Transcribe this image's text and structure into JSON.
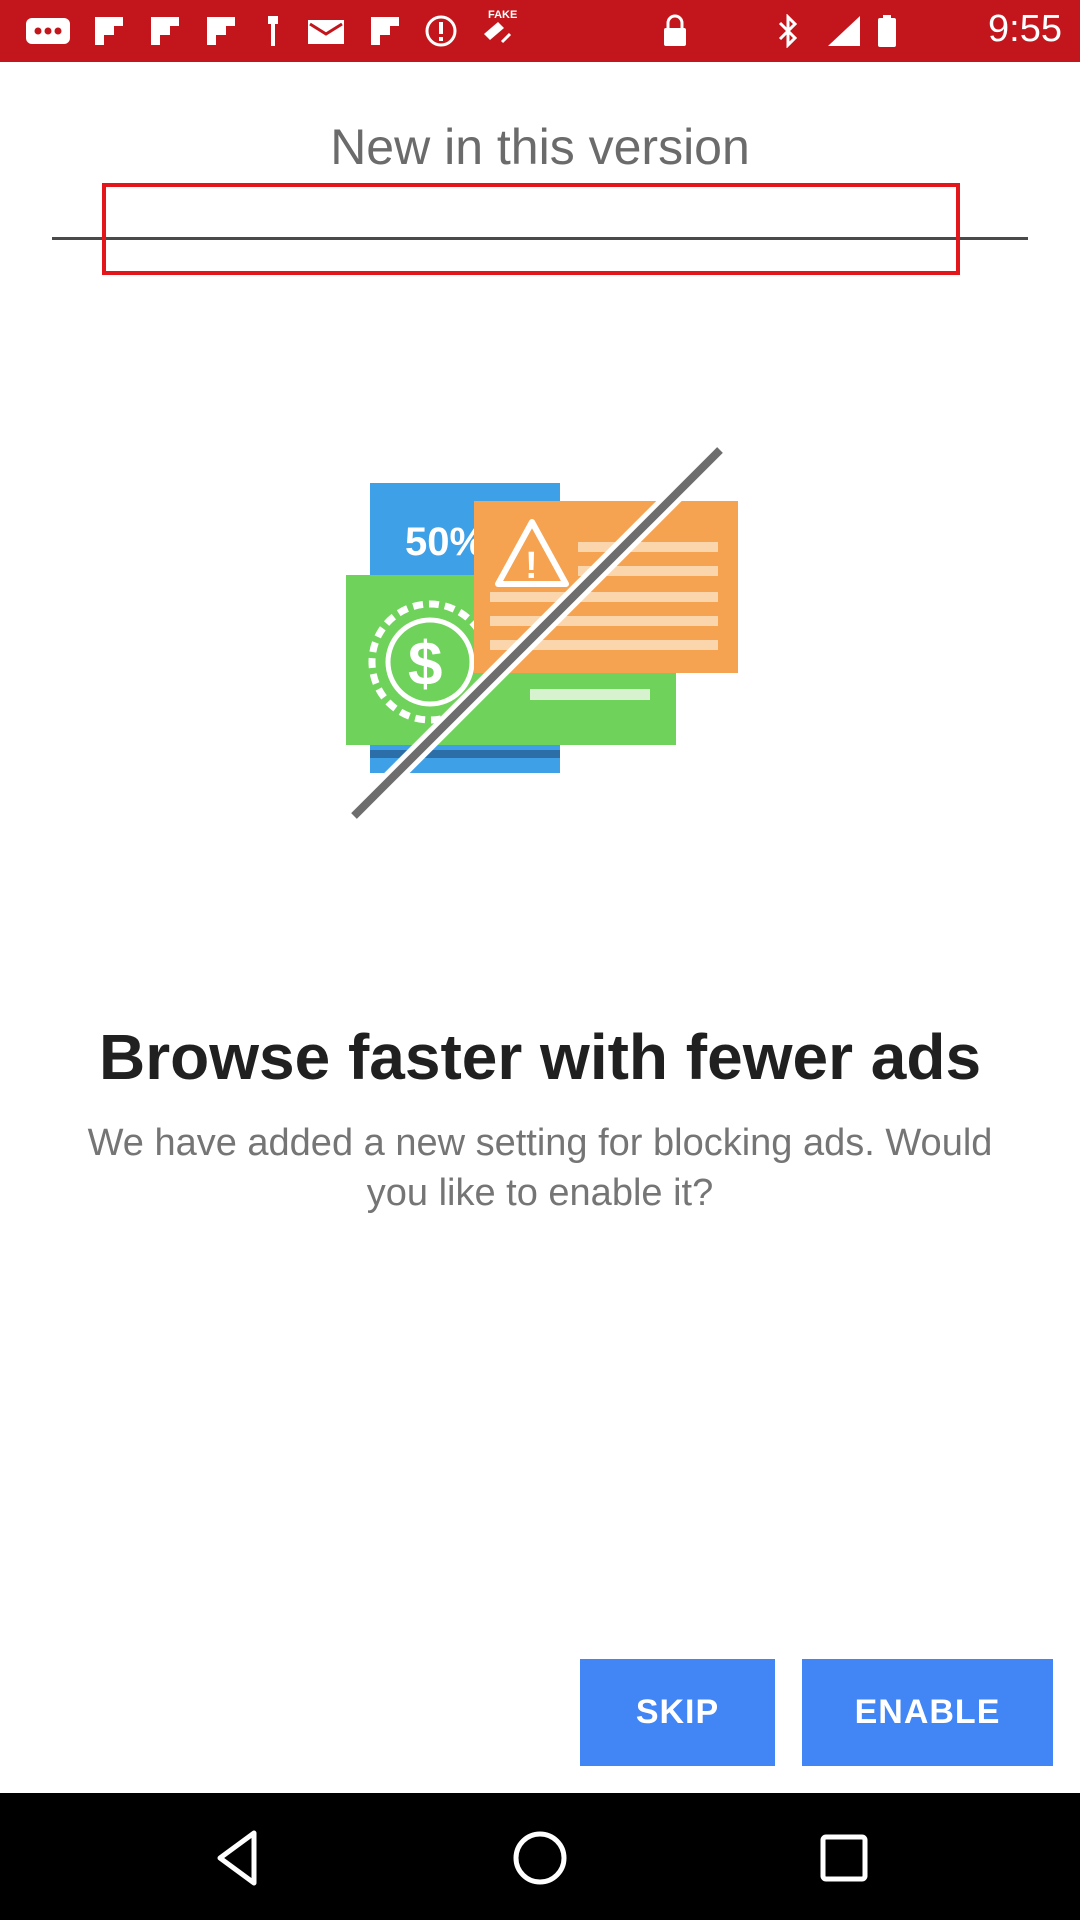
{
  "status_bar": {
    "time": "9:55",
    "icons": [
      "more-icon",
      "flipboard-icon",
      "flipboard-icon",
      "flipboard-icon",
      "tuning-icon",
      "mail-icon",
      "flipboard-icon",
      "alert-icon",
      "fake-gps-icon",
      "lock-icon",
      "bluetooth-icon",
      "signal-icon",
      "battery-icon"
    ],
    "fake_label": "FAKE",
    "background_color": "#c2161c"
  },
  "header": {
    "title": "New in this version"
  },
  "illustration": {
    "promo_text": "50%",
    "currency_symbol": "$",
    "alert_symbol": "!"
  },
  "content": {
    "headline": "Browse faster with fewer ads",
    "description": "We have added a new setting for blocking ads. Would you like to enable it?"
  },
  "buttons": {
    "skip_label": "SKIP",
    "enable_label": "ENABLE",
    "accent_color": "#4285f4"
  },
  "nav_bar": {
    "icons": [
      "back-icon",
      "home-icon",
      "recents-icon"
    ]
  }
}
